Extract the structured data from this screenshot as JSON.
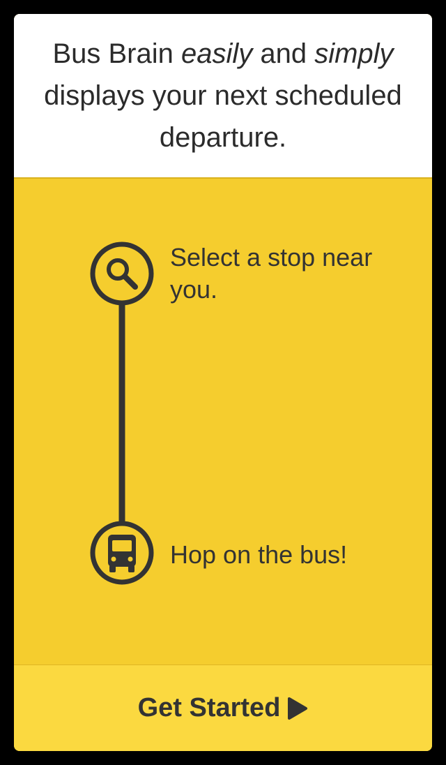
{
  "intro": {
    "part1": "Bus Brain ",
    "em1": "easily",
    "part2": " and ",
    "em2": "simply",
    "part3": " displays your next scheduled departure."
  },
  "steps": [
    {
      "icon": "search-icon",
      "text": "Select a stop near you."
    },
    {
      "icon": "bus-icon",
      "text": "Hop on the bus!"
    }
  ],
  "cta": {
    "label": "Get Started",
    "icon": "play-arrow-icon"
  },
  "colors": {
    "background": "#000000",
    "card_top": "#ffffff",
    "accent_yellow": "#f5cd2e",
    "button_yellow": "#fbd940",
    "icon_dark": "#333333"
  }
}
